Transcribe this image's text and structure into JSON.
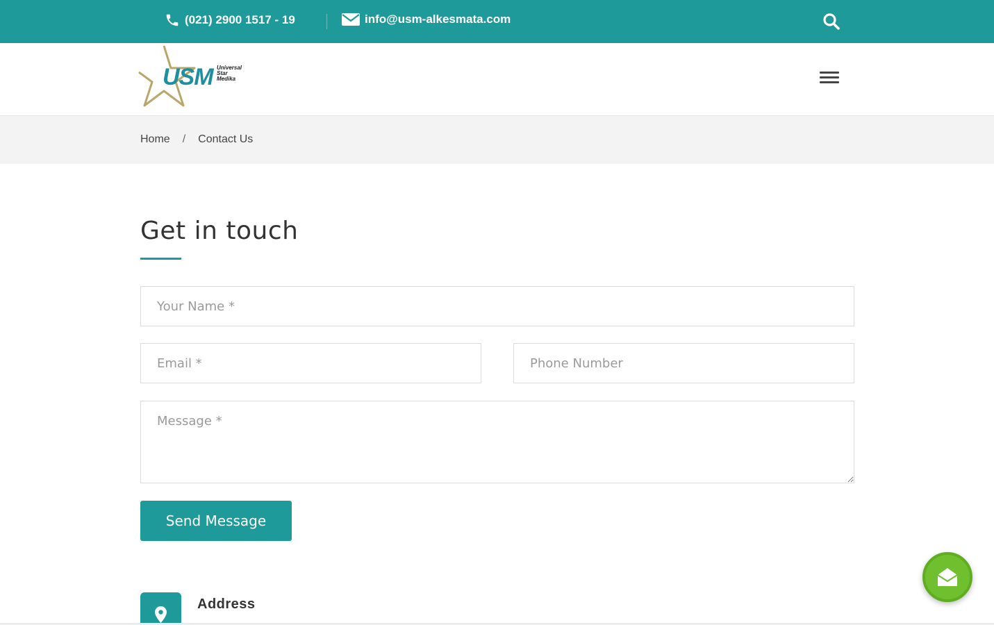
{
  "topbar": {
    "phone": "(021) 2900 1517 - 19",
    "email": "info@usm-alkesmata.com",
    "phone_icon": "phone-icon",
    "email_icon": "envelope-icon",
    "search_icon": "search-icon"
  },
  "header": {
    "logo_text": "USM",
    "logo_sub": [
      "Universal",
      "Star",
      "Medika"
    ],
    "menu_icon": "hamburger-menu-icon"
  },
  "breadcrumb": {
    "home": "Home",
    "separator": "/",
    "current": "Contact Us"
  },
  "form": {
    "title": "Get in touch",
    "name_placeholder": "Your Name *",
    "email_placeholder": "Email *",
    "phone_placeholder": "Phone Number",
    "message_placeholder": "Message *",
    "submit_label": "Send Message"
  },
  "info": {
    "address_label": "Address",
    "address_icon": "map-pin-icon"
  },
  "floating": {
    "icon": "envelope-open-icon"
  },
  "colors": {
    "accent": "#1f9a9a",
    "float_button": "#6fbf2e",
    "breadcrumb_bg": "#f3f3f3"
  }
}
